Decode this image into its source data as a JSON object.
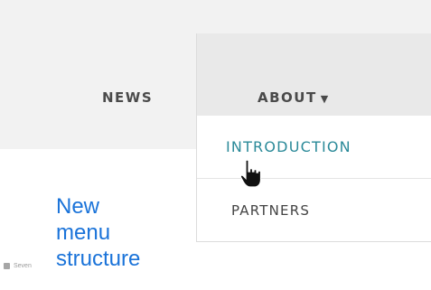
{
  "nav": {
    "news_label": "NEWS",
    "about_label": "ABOUT",
    "about_caret": "▼"
  },
  "dropdown": {
    "items": [
      {
        "label": "INTRODUCTION",
        "state": "hovered"
      },
      {
        "label": "PARTNERS"
      }
    ]
  },
  "caption": {
    "line1": "New",
    "line2": "menu",
    "line3": "structure"
  },
  "brand": {
    "name": "Seven"
  },
  "colors": {
    "hover_link": "#2b8a99",
    "caption_text": "#1a73d9",
    "nav_text": "#4a4a4a"
  }
}
